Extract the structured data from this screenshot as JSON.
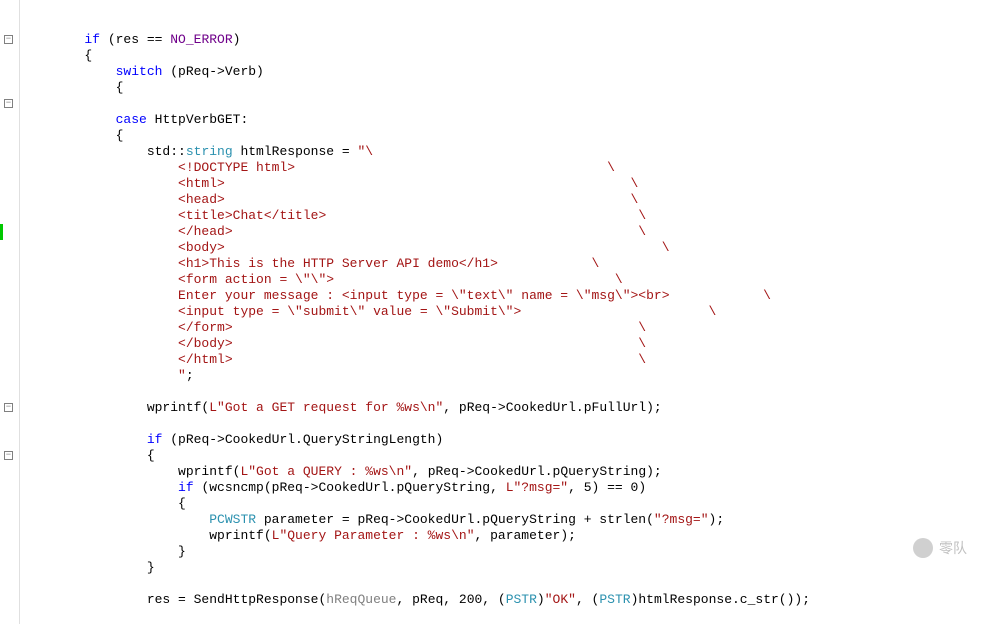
{
  "code": {
    "lines": [
      {
        "indent": 8,
        "tokens": [
          {
            "t": "if",
            "c": "keyword"
          },
          {
            "t": " (res == ",
            "c": "punct"
          },
          {
            "t": "NO_ERROR",
            "c": "macro"
          },
          {
            "t": ")",
            "c": "punct"
          }
        ]
      },
      {
        "indent": 8,
        "tokens": [
          {
            "t": "{",
            "c": "punct"
          }
        ]
      },
      {
        "indent": 12,
        "tokens": [
          {
            "t": "switch",
            "c": "keyword"
          },
          {
            "t": " (pReq->Verb)",
            "c": "punct"
          }
        ]
      },
      {
        "indent": 12,
        "tokens": [
          {
            "t": "{",
            "c": "punct"
          }
        ]
      },
      {
        "indent": 0,
        "tokens": []
      },
      {
        "indent": 12,
        "tokens": [
          {
            "t": "case",
            "c": "keyword"
          },
          {
            "t": " HttpVerbGET:",
            "c": "punct"
          }
        ]
      },
      {
        "indent": 12,
        "tokens": [
          {
            "t": "{",
            "c": "punct"
          }
        ]
      },
      {
        "indent": 16,
        "tokens": [
          {
            "t": "std::",
            "c": "punct"
          },
          {
            "t": "string",
            "c": "string-type"
          },
          {
            "t": " htmlResponse = ",
            "c": "punct"
          },
          {
            "t": "\"\\",
            "c": "string"
          }
        ]
      },
      {
        "indent": 20,
        "tokens": [
          {
            "t": "<!DOCTYPE html>",
            "c": "string"
          },
          {
            "t": "                                        \\",
            "c": "string"
          }
        ]
      },
      {
        "indent": 20,
        "tokens": [
          {
            "t": "<html>",
            "c": "string"
          },
          {
            "t": "                                                    \\",
            "c": "string"
          }
        ]
      },
      {
        "indent": 20,
        "tokens": [
          {
            "t": "<head>",
            "c": "string"
          },
          {
            "t": "                                                    \\",
            "c": "string"
          }
        ]
      },
      {
        "indent": 20,
        "tokens": [
          {
            "t": "<title>Chat</title>",
            "c": "string"
          },
          {
            "t": "                                        \\",
            "c": "string"
          }
        ]
      },
      {
        "indent": 20,
        "tokens": [
          {
            "t": "</head>",
            "c": "string"
          },
          {
            "t": "                                                    \\",
            "c": "string"
          }
        ]
      },
      {
        "indent": 20,
        "tokens": [
          {
            "t": "<body>",
            "c": "string"
          },
          {
            "t": "                                                        \\",
            "c": "string"
          }
        ]
      },
      {
        "indent": 20,
        "tokens": [
          {
            "t": "<h1>This is the HTTP Server API demo</h1>",
            "c": "string"
          },
          {
            "t": "            \\",
            "c": "string"
          }
        ]
      },
      {
        "indent": 20,
        "tokens": [
          {
            "t": "<form action = \\\"\\\">",
            "c": "string"
          },
          {
            "t": "                                    \\",
            "c": "string"
          }
        ]
      },
      {
        "indent": 20,
        "tokens": [
          {
            "t": "Enter your message : <input type = \\\"text\\\" name = \\\"msg\\\"><br>",
            "c": "string"
          },
          {
            "t": "            \\",
            "c": "string"
          }
        ]
      },
      {
        "indent": 20,
        "tokens": [
          {
            "t": "<input type = \\\"submit\\\" value = \\\"Submit\\\">",
            "c": "string"
          },
          {
            "t": "                        \\",
            "c": "string"
          }
        ]
      },
      {
        "indent": 20,
        "tokens": [
          {
            "t": "</form>",
            "c": "string"
          },
          {
            "t": "                                                    \\",
            "c": "string"
          }
        ]
      },
      {
        "indent": 20,
        "tokens": [
          {
            "t": "</body>",
            "c": "string"
          },
          {
            "t": "                                                    \\",
            "c": "string"
          }
        ]
      },
      {
        "indent": 20,
        "tokens": [
          {
            "t": "</html>",
            "c": "string"
          },
          {
            "t": "                                                    \\",
            "c": "string"
          }
        ]
      },
      {
        "indent": 20,
        "tokens": [
          {
            "t": "\"",
            "c": "string"
          },
          {
            "t": ";",
            "c": "punct"
          }
        ]
      },
      {
        "indent": 0,
        "tokens": []
      },
      {
        "indent": 16,
        "tokens": [
          {
            "t": "wprintf(",
            "c": "punct"
          },
          {
            "t": "L\"Got a GET request for %ws\\n\"",
            "c": "string"
          },
          {
            "t": ", pReq->CookedUrl.pFullUrl);",
            "c": "punct"
          }
        ]
      },
      {
        "indent": 0,
        "tokens": []
      },
      {
        "indent": 16,
        "tokens": [
          {
            "t": "if",
            "c": "keyword"
          },
          {
            "t": " (pReq->CookedUrl.QueryStringLength)",
            "c": "punct"
          }
        ]
      },
      {
        "indent": 16,
        "tokens": [
          {
            "t": "{",
            "c": "punct"
          }
        ]
      },
      {
        "indent": 20,
        "tokens": [
          {
            "t": "wprintf(",
            "c": "punct"
          },
          {
            "t": "L\"Got a QUERY : %ws\\n\"",
            "c": "string"
          },
          {
            "t": ", pReq->CookedUrl.pQueryString);",
            "c": "punct"
          }
        ]
      },
      {
        "indent": 20,
        "tokens": [
          {
            "t": "if",
            "c": "keyword"
          },
          {
            "t": " (wcsncmp(pReq->CookedUrl.pQueryString, ",
            "c": "punct"
          },
          {
            "t": "L\"?msg=\"",
            "c": "string"
          },
          {
            "t": ", 5) == 0)",
            "c": "punct"
          }
        ]
      },
      {
        "indent": 20,
        "tokens": [
          {
            "t": "{",
            "c": "punct"
          }
        ]
      },
      {
        "indent": 24,
        "tokens": [
          {
            "t": "PCWSTR",
            "c": "string-type"
          },
          {
            "t": " parameter = pReq->CookedUrl.pQueryString + strlen(",
            "c": "punct"
          },
          {
            "t": "\"?msg=\"",
            "c": "string"
          },
          {
            "t": ");",
            "c": "punct"
          }
        ]
      },
      {
        "indent": 24,
        "tokens": [
          {
            "t": "wprintf(",
            "c": "punct"
          },
          {
            "t": "L\"Query Parameter : %ws\\n\"",
            "c": "string"
          },
          {
            "t": ", parameter);",
            "c": "punct"
          }
        ]
      },
      {
        "indent": 20,
        "tokens": [
          {
            "t": "}",
            "c": "punct"
          }
        ]
      },
      {
        "indent": 16,
        "tokens": [
          {
            "t": "}",
            "c": "punct"
          }
        ]
      },
      {
        "indent": 0,
        "tokens": []
      },
      {
        "indent": 16,
        "tokens": [
          {
            "t": "res = SendHttpResponse(",
            "c": "punct"
          },
          {
            "t": "hReqQueue",
            "c": "param-gray"
          },
          {
            "t": ", pReq, 200, (",
            "c": "punct"
          },
          {
            "t": "PSTR",
            "c": "cast-type"
          },
          {
            "t": ")",
            "c": "punct"
          },
          {
            "t": "\"OK\"",
            "c": "string"
          },
          {
            "t": ", (",
            "c": "punct"
          },
          {
            "t": "PSTR",
            "c": "cast-type"
          },
          {
            "t": ")htmlResponse.c_str());",
            "c": "punct"
          }
        ]
      }
    ]
  },
  "foldMarkers": [
    {
      "line": 2,
      "symbol": "−"
    },
    {
      "line": 6,
      "symbol": "−"
    },
    {
      "line": 25,
      "symbol": "−"
    },
    {
      "line": 28,
      "symbol": "−"
    }
  ],
  "greenMarker": {
    "line": 14
  },
  "watermark": "零队"
}
